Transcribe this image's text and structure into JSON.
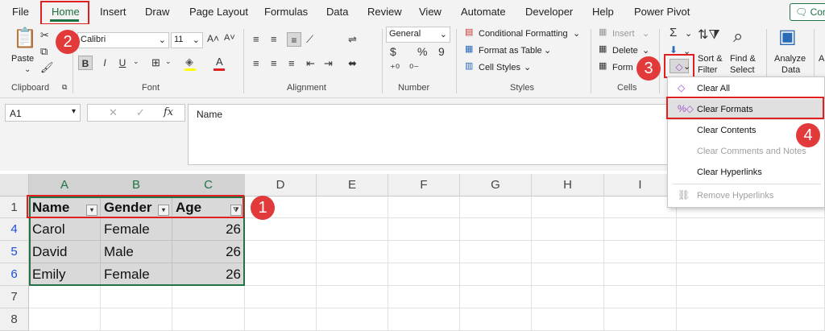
{
  "menu": {
    "file": "File",
    "home": "Home",
    "insert": "Insert",
    "draw": "Draw",
    "page_layout": "Page Layout",
    "formulas": "Formulas",
    "data": "Data",
    "review": "Review",
    "view": "View",
    "automate": "Automate",
    "developer": "Developer",
    "help": "Help",
    "power_pivot": "Power Pivot",
    "comments": "Cor"
  },
  "ribbon": {
    "clipboard": {
      "paste": "Paste",
      "label": "Clipboard"
    },
    "font": {
      "name": "Calibri",
      "size": "11",
      "bold": "B",
      "italic": "I",
      "underline": "U",
      "label": "Font"
    },
    "alignment": {
      "label": "Alignment"
    },
    "number": {
      "format": "General",
      "currency": "$",
      "percent": "%",
      "comma": "9",
      "label": "Number"
    },
    "styles": {
      "conditional": "Conditional Formatting",
      "format_table": "Format as Table",
      "cell_styles": "Cell Styles",
      "label": "Styles"
    },
    "cells": {
      "insert": "Insert",
      "delete": "Delete",
      "format": "Form",
      "label": "Cells"
    },
    "editing": {
      "sort_filter_1": "Sort &",
      "sort_filter_2": "Filter",
      "find_select_1": "Find &",
      "find_select_2": "Select",
      "sum": "Σ"
    },
    "analysis": {
      "analyze_1": "Analyze",
      "analyze_2": "Data",
      "label": "A"
    }
  },
  "formula_bar": {
    "name_box": "A1",
    "fx": "fx",
    "value": "Name"
  },
  "grid": {
    "columns": [
      "A",
      "B",
      "C",
      "D",
      "E",
      "F",
      "G",
      "H",
      "I"
    ],
    "rows": [
      "1",
      "4",
      "5",
      "6",
      "7",
      "8"
    ],
    "headers": [
      "Name",
      "Gender",
      "Age"
    ],
    "data": [
      [
        "Carol",
        "Female",
        "26"
      ],
      [
        "David",
        "Male",
        "26"
      ],
      [
        "Emily",
        "Female",
        "26"
      ]
    ]
  },
  "clear_menu": {
    "clear_all": "Clear All",
    "clear_formats": "Clear Formats",
    "clear_contents": "Clear Contents",
    "clear_comments": "Clear Comments and Notes",
    "clear_hyperlinks": "Clear Hyperlinks",
    "remove_hyperlinks": "Remove Hyperlinks"
  },
  "steps": {
    "one": "1",
    "two": "2",
    "three": "3",
    "four": "4"
  },
  "colors": {
    "excel_green": "#217346",
    "annotation_red": "#e23a3a",
    "selection_gray": "#d9d9d9"
  }
}
